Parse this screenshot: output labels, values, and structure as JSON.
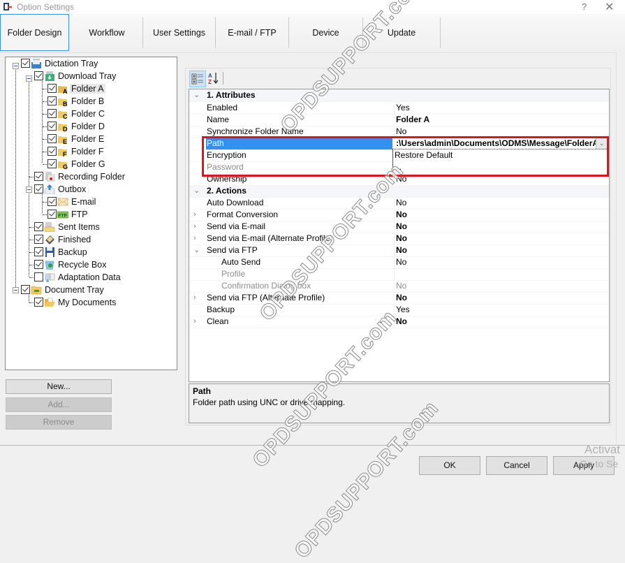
{
  "window": {
    "title": "Option Settings",
    "help_glyph": "?",
    "close_glyph": "✕"
  },
  "tabs": [
    {
      "label": "Folder Design",
      "active": true
    },
    {
      "label": "Workflow"
    },
    {
      "label": "User Settings"
    },
    {
      "label": "E-mail / FTP"
    },
    {
      "label": "Device"
    },
    {
      "label": "Update"
    }
  ],
  "tree": {
    "nodes": [
      {
        "label": "Dictation Tray",
        "checked": true,
        "icon": "dictation-tray-icon"
      },
      {
        "label": "Download Tray",
        "checked": true,
        "icon": "download-tray-icon"
      },
      {
        "label": "Folder A",
        "checked": true,
        "icon": "folder-a-icon",
        "letter": "A",
        "selected": true
      },
      {
        "label": "Folder B",
        "checked": true,
        "icon": "folder-b-icon",
        "letter": "B"
      },
      {
        "label": "Folder C",
        "checked": true,
        "icon": "folder-c-icon",
        "letter": "C"
      },
      {
        "label": "Folder D",
        "checked": true,
        "icon": "folder-d-icon",
        "letter": "D"
      },
      {
        "label": "Folder E",
        "checked": true,
        "icon": "folder-e-icon",
        "letter": "E"
      },
      {
        "label": "Folder F",
        "checked": true,
        "icon": "folder-f-icon",
        "letter": "F"
      },
      {
        "label": "Folder G",
        "checked": true,
        "icon": "folder-g-icon",
        "letter": "G"
      },
      {
        "label": "Recording Folder",
        "checked": true,
        "icon": "recording-folder-icon"
      },
      {
        "label": "Outbox",
        "checked": true,
        "icon": "outbox-icon"
      },
      {
        "label": "E-mail",
        "checked": true,
        "icon": "email-envelope-icon"
      },
      {
        "label": "FTP",
        "checked": true,
        "icon": "ftp-icon",
        "badge": "FTP"
      },
      {
        "label": "Sent Items",
        "checked": true,
        "icon": "sent-items-icon"
      },
      {
        "label": "Finished",
        "checked": true,
        "icon": "finished-icon"
      },
      {
        "label": "Backup",
        "checked": true,
        "icon": "backup-floppy-icon"
      },
      {
        "label": "Recycle Box",
        "checked": true,
        "icon": "recycle-box-icon"
      },
      {
        "label": "Adaptation Data",
        "checked": false,
        "icon": "adaptation-data-icon"
      },
      {
        "label": "Document Tray",
        "checked": true,
        "icon": "document-tray-icon"
      },
      {
        "label": "My Documents",
        "checked": true,
        "icon": "my-documents-folder-icon"
      }
    ]
  },
  "tree_buttons": {
    "new": "New...",
    "add": "Add...",
    "remove": "Remove"
  },
  "property_grid": {
    "toolbar": {
      "categorized": "categorized-view",
      "alphabetical": "alphabetical-sort"
    },
    "rows": [
      {
        "type": "category",
        "name": "1. Attributes",
        "expanded": true
      },
      {
        "name": "Enabled",
        "value": "Yes"
      },
      {
        "name": "Name",
        "value": "Folder A",
        "bold_value": true
      },
      {
        "name": "Synchronize Folder Name",
        "value": "No"
      },
      {
        "name": "Path",
        "value": ":\\Users\\admin\\Documents\\ODMS\\Message\\FolderA",
        "bold_value": true,
        "selected": true
      },
      {
        "name": "Encryption",
        "value": ""
      },
      {
        "name": "Password",
        "value": "",
        "disabled": true
      },
      {
        "name": "Ownership",
        "value": "No"
      },
      {
        "type": "category",
        "name": "2. Actions",
        "expanded": true
      },
      {
        "name": "Auto Download",
        "value": "No"
      },
      {
        "name": "Format Conversion",
        "value": "No",
        "bold_value": true,
        "expander": "collapsed"
      },
      {
        "name": "Send via E-mail",
        "value": "No",
        "bold_value": true,
        "expander": "collapsed"
      },
      {
        "name": "Send via E-mail (Alternate Profile)",
        "value": "No",
        "bold_value": true,
        "expander": "collapsed"
      },
      {
        "name": "Send via FTP",
        "value": "No",
        "bold_value": true,
        "expander": "expanded"
      },
      {
        "name": "Auto Send",
        "value": "No",
        "sub": true
      },
      {
        "name": "Profile",
        "value": "",
        "sub": true,
        "disabled": true
      },
      {
        "name": "Confirmation Dialog box",
        "value": "No",
        "sub": true,
        "disabled": true
      },
      {
        "name": "Send via FTP (Alternate Profile)",
        "value": "No",
        "bold_value": true,
        "expander": "collapsed"
      },
      {
        "name": "Backup",
        "value": "Yes"
      },
      {
        "name": "Clean",
        "value": "No",
        "bold_value": true,
        "expander": "collapsed"
      }
    ],
    "dropdown_options": [
      "Restore Default",
      "..."
    ],
    "description": {
      "title": "Path",
      "text": "Folder path using UNC or drive mapping."
    }
  },
  "dialog_buttons": {
    "ok": "OK",
    "cancel": "Cancel",
    "apply": "Apply"
  },
  "overlays": {
    "watermark": "OPDSUPPORT.com",
    "activate_line1": "Activat",
    "activate_line2": "Go to Se"
  },
  "colors": {
    "selection": "#3390f0",
    "highlight_box": "#e0141e",
    "active_tab_border": "#3d8ee8"
  }
}
